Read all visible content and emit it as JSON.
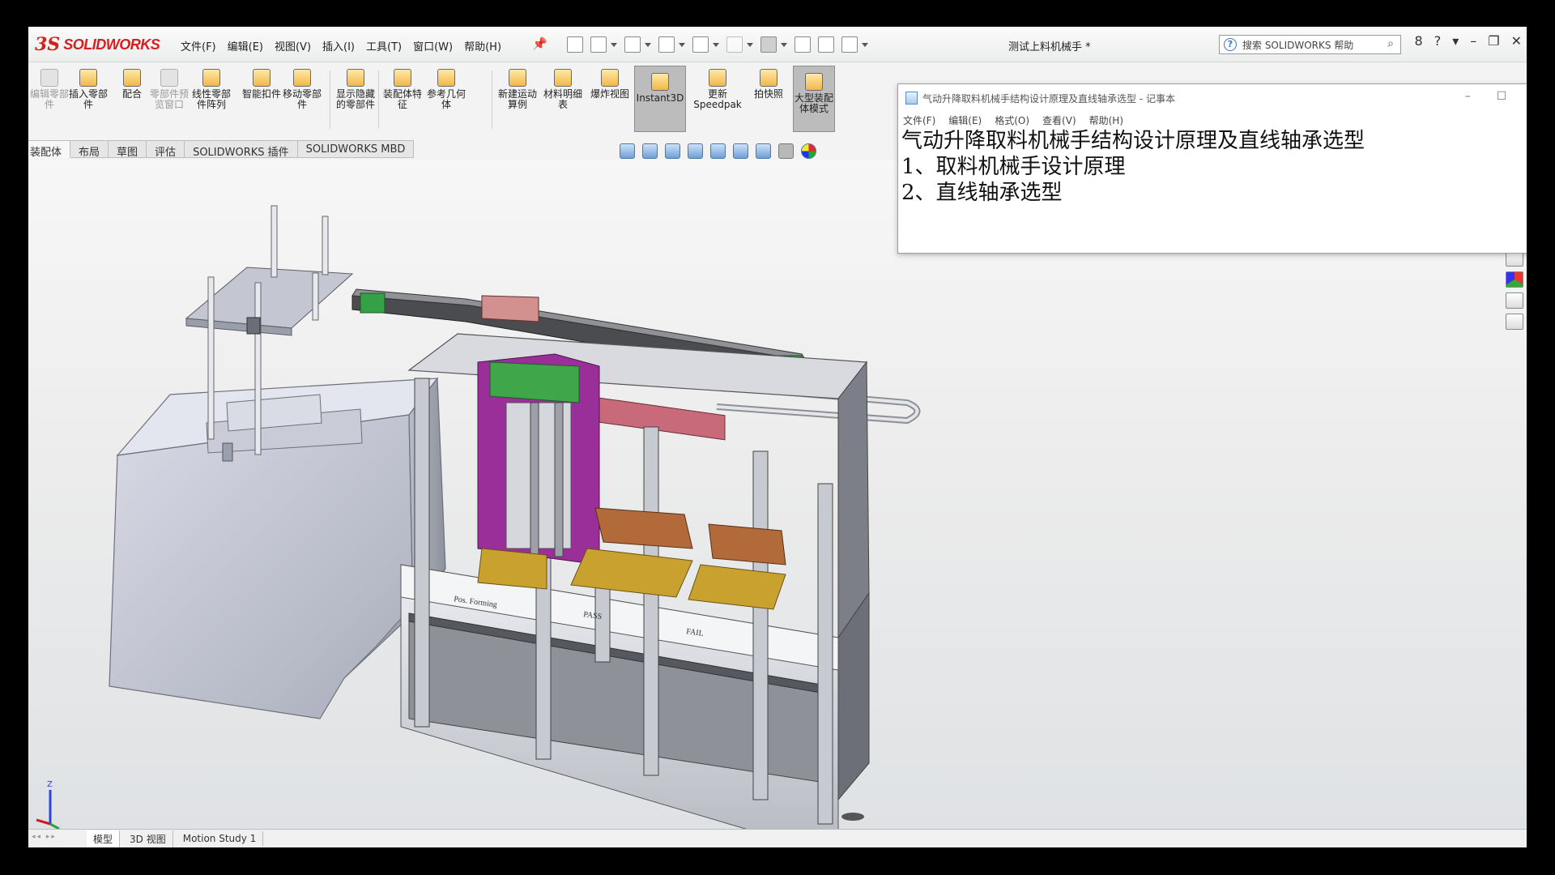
{
  "app": {
    "logo_ds": "3S",
    "logo_name": "SOLIDWORKS",
    "menu": [
      "文件(F)",
      "编辑(E)",
      "视图(V)",
      "插入(I)",
      "工具(T)",
      "窗口(W)",
      "帮助(H)"
    ],
    "doc_title": "测试上料机械手 *",
    "search_placeholder": "搜索 SOLIDWORKS 帮助",
    "window_controls": [
      "8",
      "?",
      "▾",
      "–",
      "❐",
      "✕"
    ]
  },
  "command_manager": {
    "commands": [
      {
        "label": "编辑零部件",
        "state": "dim",
        "icon": "edit-component-icon"
      },
      {
        "label": "插入零部件",
        "state": "normal",
        "icon": "insert-component-icon"
      },
      {
        "label": "配合",
        "state": "normal",
        "icon": "mate-icon"
      },
      {
        "label": "零部件预览窗口",
        "state": "dim",
        "icon": "component-preview-icon"
      },
      {
        "label": "线性零部件阵列",
        "state": "normal",
        "icon": "linear-pattern-icon"
      },
      {
        "label": "智能扣件",
        "state": "normal",
        "icon": "smart-fasteners-icon"
      },
      {
        "label": "移动零部件",
        "state": "normal",
        "icon": "move-component-icon"
      },
      {
        "label": "显示隐藏的零部件",
        "state": "normal",
        "icon": "show-hidden-icon"
      },
      {
        "label": "装配体特征",
        "state": "normal",
        "icon": "assembly-features-icon"
      },
      {
        "label": "参考几何体",
        "state": "normal",
        "icon": "reference-geometry-icon"
      },
      {
        "label": "新建运动算例",
        "state": "normal",
        "icon": "motion-study-icon"
      },
      {
        "label": "材料明细表",
        "state": "normal",
        "icon": "bom-icon"
      },
      {
        "label": "爆炸视图",
        "state": "normal",
        "icon": "exploded-view-icon"
      },
      {
        "label": "Instant3D",
        "state": "active",
        "icon": "instant3d-icon"
      },
      {
        "label": "更新Speedpak",
        "state": "normal",
        "icon": "speedpak-icon"
      },
      {
        "label": "拍快照",
        "state": "normal",
        "icon": "snapshot-icon"
      },
      {
        "label": "大型装配体模式",
        "state": "active",
        "icon": "large-assembly-icon"
      }
    ]
  },
  "tabs": [
    "装配体",
    "布局",
    "草图",
    "评估",
    "SOLIDWORKS 插件",
    "SOLIDWORKS MBD"
  ],
  "bottom_tabs": [
    "模型",
    "3D 视图",
    "Motion Study 1"
  ],
  "notepad": {
    "title": "气动升降取料机械手结构设计原理及直线轴承选型 - 记事本",
    "menu": [
      "文件(F)",
      "编辑(E)",
      "格式(O)",
      "查看(V)",
      "帮助(H)"
    ],
    "lines": [
      "气动升降取料机械手结构设计原理及直线轴承选型",
      "1、取料机械手设计原理",
      "2、直线轴承选型"
    ],
    "controls": [
      "–",
      "☐",
      "✕"
    ]
  },
  "model_labels": [
    "Pos. Forming",
    "PASS",
    "FAIL"
  ],
  "triad_axis": "Z",
  "colors": {
    "brand": "#d81e1e",
    "frame": "#b9bcc4",
    "machine_base": "#c3c7d3",
    "rail": "#555555",
    "gripper_purple": "#9a2f9a",
    "gripper_green": "#3fa64a",
    "tray_orange": "#c46a2a"
  }
}
